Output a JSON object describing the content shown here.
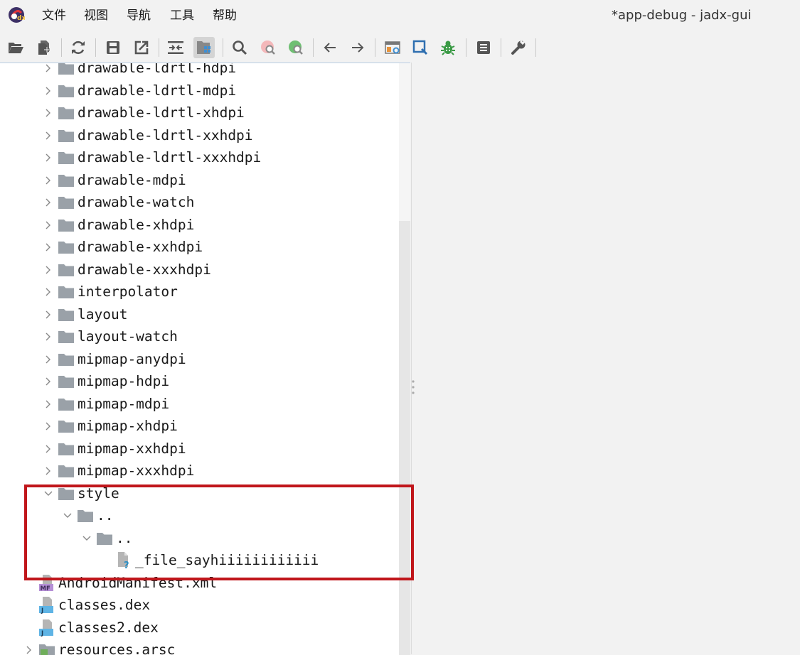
{
  "menubar": {
    "items": [
      "文件",
      "视图",
      "导航",
      "工具",
      "帮助"
    ],
    "window_title": "*app-debug - jadx-gui"
  },
  "toolbar": {
    "buttons": [
      "open-folder-icon",
      "add-files-icon",
      "sync-icon",
      "save-icon",
      "export-icon",
      "flatten-packages-icon",
      "sync-tree-icon",
      "search-icon",
      "find-usage-icon",
      "find-class-icon",
      "back-icon",
      "forward-icon",
      "deobfuscation-icon",
      "quark-icon",
      "debugger-icon",
      "log-icon",
      "settings-icon"
    ],
    "active": "sync-tree-icon"
  },
  "tree": {
    "items": [
      {
        "label": "drawable-ldrtl-hdpi",
        "type": "folder",
        "expanded": false
      },
      {
        "label": "drawable-ldrtl-mdpi",
        "type": "folder",
        "expanded": false
      },
      {
        "label": "drawable-ldrtl-xhdpi",
        "type": "folder",
        "expanded": false
      },
      {
        "label": "drawable-ldrtl-xxhdpi",
        "type": "folder",
        "expanded": false
      },
      {
        "label": "drawable-ldrtl-xxxhdpi",
        "type": "folder",
        "expanded": false
      },
      {
        "label": "drawable-mdpi",
        "type": "folder",
        "expanded": false
      },
      {
        "label": "drawable-watch",
        "type": "folder",
        "expanded": false
      },
      {
        "label": "drawable-xhdpi",
        "type": "folder",
        "expanded": false
      },
      {
        "label": "drawable-xxhdpi",
        "type": "folder",
        "expanded": false
      },
      {
        "label": "drawable-xxxhdpi",
        "type": "folder",
        "expanded": false
      },
      {
        "label": "interpolator",
        "type": "folder",
        "expanded": false
      },
      {
        "label": "layout",
        "type": "folder",
        "expanded": false
      },
      {
        "label": "layout-watch",
        "type": "folder",
        "expanded": false
      },
      {
        "label": "mipmap-anydpi",
        "type": "folder",
        "expanded": false
      },
      {
        "label": "mipmap-hdpi",
        "type": "folder",
        "expanded": false
      },
      {
        "label": "mipmap-mdpi",
        "type": "folder",
        "expanded": false
      },
      {
        "label": "mipmap-xhdpi",
        "type": "folder",
        "expanded": false
      },
      {
        "label": "mipmap-xxhdpi",
        "type": "folder",
        "expanded": false
      },
      {
        "label": "mipmap-xxxhdpi",
        "type": "folder",
        "expanded": false
      },
      {
        "label": "style",
        "type": "folder",
        "expanded": true
      },
      {
        "label": "..",
        "type": "folder",
        "expanded": true
      },
      {
        "label": "..",
        "type": "folder",
        "expanded": true
      },
      {
        "label": "_file_sayhiiiiiiiiiiii",
        "type": "unknown-file"
      },
      {
        "label": "AndroidManifest.xml",
        "type": "manifest-file",
        "badge": "MF"
      },
      {
        "label": "classes.dex",
        "type": "java-file",
        "badge": "J"
      },
      {
        "label": "classes2.dex",
        "type": "java-file",
        "badge": "J"
      },
      {
        "label": "resources.arsc",
        "type": "arsc-file",
        "expanded": false
      }
    ]
  },
  "colors": {
    "highlight_border": "#c0161b",
    "folder_icon": "#9aa1a8",
    "tree_background": "#ffffff",
    "window_background": "#f2f2f2"
  }
}
